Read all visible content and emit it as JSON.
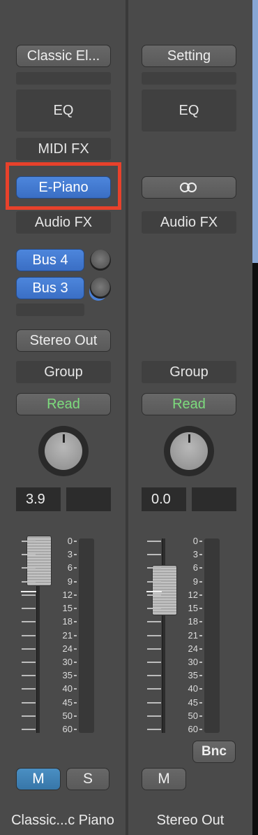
{
  "strip1": {
    "name": "Classic...c Piano",
    "setting": "Classic El...",
    "eq": "EQ",
    "midi_fx": "MIDI FX",
    "instrument": "E-Piano",
    "audio_fx": "Audio FX",
    "sends": [
      {
        "label": "Bus 4"
      },
      {
        "label": "Bus 3"
      }
    ],
    "output": "Stereo Out",
    "group": "Group",
    "automation": "Read",
    "gain_value": "3.9",
    "peak_value": "",
    "mute": "M",
    "solo": "S"
  },
  "strip2": {
    "name": "Stereo Out",
    "setting": "Setting",
    "eq": "EQ",
    "insert_icon": "stereo-link-icon",
    "audio_fx": "Audio FX",
    "group": "Group",
    "automation": "Read",
    "gain_value": "0.0",
    "peak_value": "",
    "bounce": "Bnc",
    "mute": "M"
  },
  "scale_labels": [
    "0",
    "3",
    "6",
    "9",
    "12",
    "15",
    "18",
    "21",
    "24",
    "30",
    "35",
    "40",
    "45",
    "50",
    "60"
  ],
  "colors": {
    "strip_bg": "#4a4a4a",
    "selected_blue": "#4a80d6",
    "read_green": "#7ddc7d",
    "mute_blue": "#3a7fb4",
    "highlight_red": "#e8412b"
  }
}
